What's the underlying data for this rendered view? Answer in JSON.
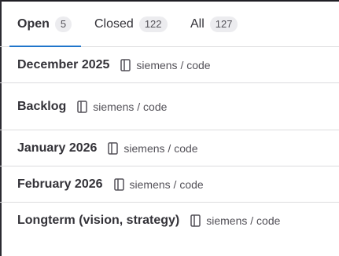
{
  "tabs": [
    {
      "label": "Open",
      "count": "5"
    },
    {
      "label": "Closed",
      "count": "122"
    },
    {
      "label": "All",
      "count": "127"
    }
  ],
  "milestones": [
    {
      "title": "December 2025",
      "project": "siemens / code",
      "icon": "project-icon"
    },
    {
      "title": "Backlog",
      "project": "siemens / code",
      "icon": "project-icon"
    },
    {
      "title": "January 2026",
      "project": "siemens / code",
      "icon": "project-icon"
    },
    {
      "title": "February 2026",
      "project": "siemens / code",
      "icon": "project-icon"
    },
    {
      "title": "Longterm (vision, strategy)",
      "project": "siemens / code",
      "icon": "project-icon"
    }
  ],
  "colors": {
    "active_tab_underline": "#1f75cb",
    "badge_background": "#ececef"
  }
}
